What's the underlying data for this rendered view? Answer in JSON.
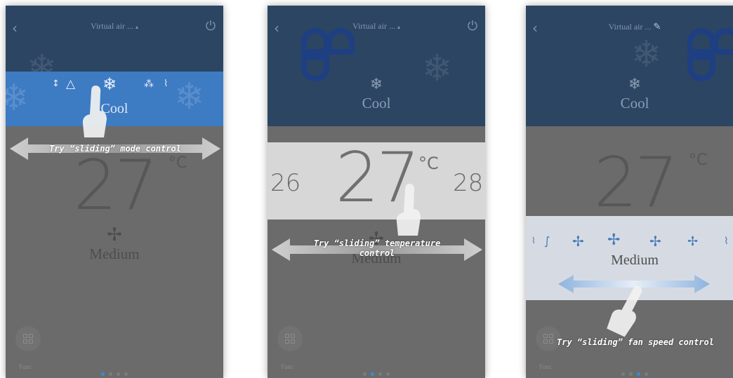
{
  "screens": [
    {
      "title": "Virtual air ...",
      "mode_icons": [
        "↕",
        "△",
        "❄",
        "⁂",
        "⌇"
      ],
      "mode_label": "Cool",
      "temp": "27",
      "unit": "°C",
      "fan_label": "Medium",
      "func_label": "Func",
      "hint": "Try “sliding” mode control"
    },
    {
      "title": "Virtual air ...",
      "mode_label": "Cool",
      "temp": "27",
      "unit": "°C",
      "prev_temp": "26",
      "next_temp": "28",
      "fan_label": "Medium",
      "func_label": "Func",
      "hint_line1": "Try “sliding” temperature",
      "hint_line2": "control"
    },
    {
      "title": "Virtual air ...",
      "mode_label": "Cool",
      "temp": "27",
      "unit": "°C",
      "fan_label": "Medium",
      "func_label": "Func",
      "hint": "Try “sliding” fan speed control"
    }
  ],
  "icons": {
    "back": "‹",
    "snowflake": "❄",
    "fan": "✢",
    "pencil": "✎"
  },
  "colors": {
    "header": "#2c4562",
    "mode_strip": "#3d7bc3",
    "overlay_gray": "#6b6b6b",
    "active_dot": "#3f87d9"
  }
}
